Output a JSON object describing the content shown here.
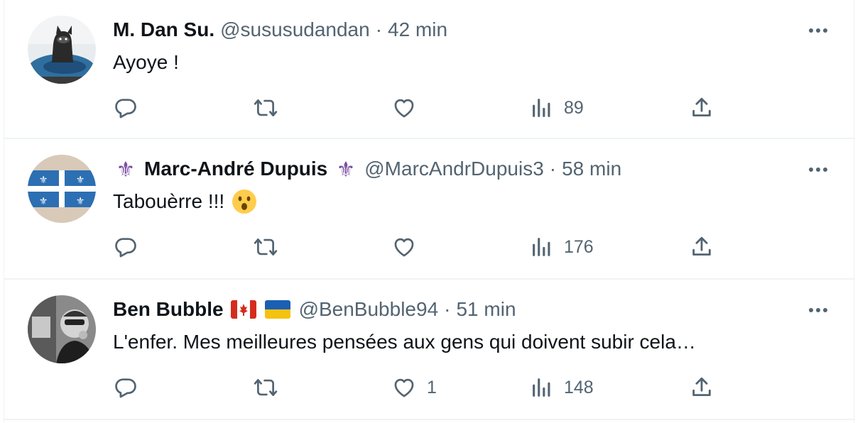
{
  "colors": {
    "text": "#0f1419",
    "secondary": "#536471",
    "divider": "#eff3f4"
  },
  "tweets": [
    {
      "name": "M. Dan Su.",
      "handle": "@susus‌udandan",
      "time": "42 min",
      "text": "Ayoye !",
      "views": "89",
      "likes": "",
      "avatar": "raccoon-photo"
    },
    {
      "name": "Marc-André Dupuis",
      "handle": "@MarcAndrDupuis3",
      "time": "58 min",
      "text": "Tabouèrre !!!",
      "views": "176",
      "likes": "",
      "avatar": "quebec-flag",
      "name_emoji": "fleur-de-lis-emoji",
      "text_emoji": "astonished-face-emoji"
    },
    {
      "name": "Ben Bubble",
      "handle": "@BenBubble94",
      "time": "51 min",
      "text": "L'enfer. Mes meilleures pensées aux gens qui doivent subir cela…",
      "views": "148",
      "likes": "1",
      "avatar": "bw-man-photo",
      "name_emoji": [
        "canada-flag-emoji",
        "ukraine-flag-emoji"
      ]
    }
  ],
  "separator": "·"
}
